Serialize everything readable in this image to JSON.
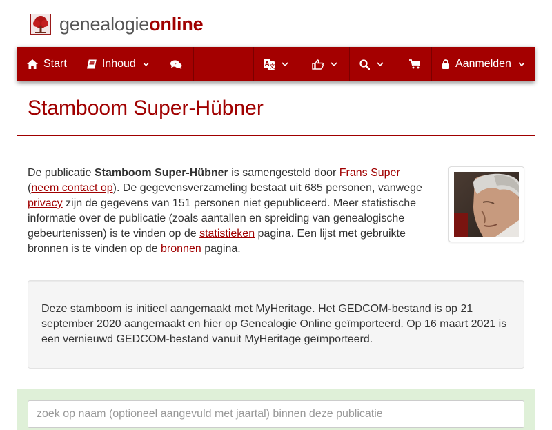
{
  "logo": {
    "prefix": "genealogie",
    "accent": "online",
    "icon": "family-tree-icon"
  },
  "nav": {
    "start": "Start",
    "inhoud": "Inhoud",
    "login": "Aanmelden",
    "icons": [
      "home-icon",
      "book-icon",
      "comments-icon",
      "language-icon",
      "thumbs-up-icon",
      "search-icon",
      "cart-icon",
      "lock-icon"
    ]
  },
  "page": {
    "title": "Stamboom Super-Hübner"
  },
  "intro": {
    "t1": "De publicatie ",
    "pub_name": "Stamboom Super-Hübner",
    "t2": " is samengesteld door ",
    "author": "Frans Super",
    "t3": "\n(",
    "contact": "neem contact op",
    "t4": "). De gegevensverzameling bestaat uit 685 personen, vanwege ",
    "privacy": "privacy",
    "t5": " zijn de gegevens van 151 personen niet gepubliceerd. Meer statistische informatie over de publicatie (zoals aantallen en spreiding van genealogische gebeurtenissen) is te vinden op de ",
    "stats": "statistieken",
    "t6": " pagina. Een lijst met gebruikte bronnen is te vinden op de ",
    "sources": "bronnen",
    "t7": " pagina."
  },
  "info": {
    "text": "Deze stamboom is initieel aangemaakt met MyHeritage. Het GEDCOM-bestand is op 21 september 2020 aangemaakt en hier op Genealogie Online geïmporteerd. Op 16 maart 2021 is een vernieuwd GEDCOM-bestand vanuit MyHeritage geïmporteerd."
  },
  "search": {
    "placeholder": "zoek op naam (optioneel aangevuld met jaartal) binnen deze publicatie"
  },
  "colors": {
    "brand": "#a40000",
    "accent": "#a00000",
    "search_bg": "#dff0d8",
    "well_bg": "#f5f5f5"
  }
}
